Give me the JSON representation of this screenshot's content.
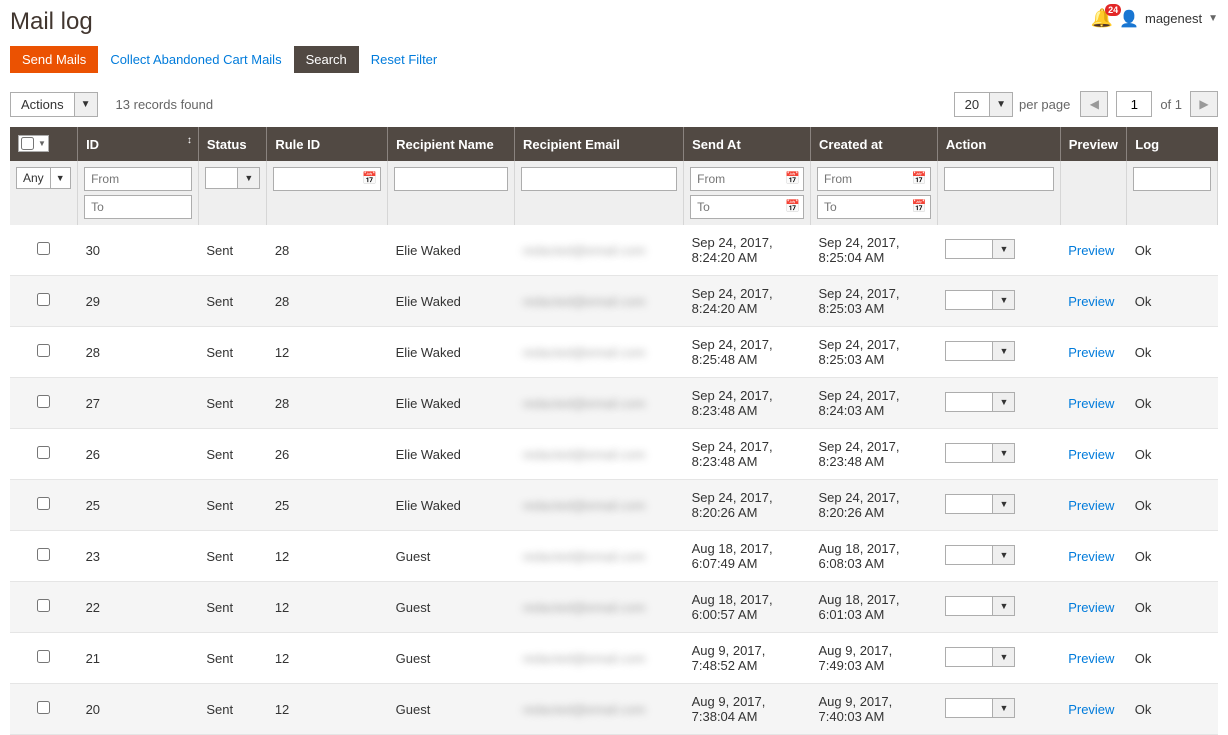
{
  "header": {
    "title": "Mail log",
    "notification_count": "24",
    "username": "magenest"
  },
  "actions": {
    "send_mails": "Send Mails",
    "collect_cart": "Collect Abandoned Cart Mails",
    "search": "Search",
    "reset_filter": "Reset Filter"
  },
  "toolbar": {
    "actions_label": "Actions",
    "records_found": "13 records found",
    "per_page_value": "20",
    "per_page_label": "per page",
    "current_page": "1",
    "total_pages": "of 1"
  },
  "columns": {
    "id": "ID",
    "status": "Status",
    "rule_id": "Rule ID",
    "recipient_name": "Recipient Name",
    "recipient_email": "Recipient Email",
    "send_at": "Send At",
    "created_at": "Created at",
    "action": "Action",
    "preview": "Preview",
    "log": "Log"
  },
  "filters": {
    "any_label": "Any",
    "from": "From",
    "to": "To"
  },
  "rows": [
    {
      "id": "30",
      "status": "Sent",
      "rule": "28",
      "name": "Elie Waked",
      "email": "redacted@email.com",
      "send": "Sep 24, 2017, 8:24:20 AM",
      "created": "Sep 24, 2017, 8:25:04 AM",
      "preview": "Preview",
      "log": "Ok"
    },
    {
      "id": "29",
      "status": "Sent",
      "rule": "28",
      "name": "Elie Waked",
      "email": "redacted@email.com",
      "send": "Sep 24, 2017, 8:24:20 AM",
      "created": "Sep 24, 2017, 8:25:03 AM",
      "preview": "Preview",
      "log": "Ok"
    },
    {
      "id": "28",
      "status": "Sent",
      "rule": "12",
      "name": "Elie Waked",
      "email": "redacted@email.com",
      "send": "Sep 24, 2017, 8:25:48 AM",
      "created": "Sep 24, 2017, 8:25:03 AM",
      "preview": "Preview",
      "log": "Ok"
    },
    {
      "id": "27",
      "status": "Sent",
      "rule": "28",
      "name": "Elie Waked",
      "email": "redacted@email.com",
      "send": "Sep 24, 2017, 8:23:48 AM",
      "created": "Sep 24, 2017, 8:24:03 AM",
      "preview": "Preview",
      "log": "Ok"
    },
    {
      "id": "26",
      "status": "Sent",
      "rule": "26",
      "name": "Elie Waked",
      "email": "redacted@email.com",
      "send": "Sep 24, 2017, 8:23:48 AM",
      "created": "Sep 24, 2017, 8:23:48 AM",
      "preview": "Preview",
      "log": "Ok"
    },
    {
      "id": "25",
      "status": "Sent",
      "rule": "25",
      "name": "Elie Waked",
      "email": "redacted@email.com",
      "send": "Sep 24, 2017, 8:20:26 AM",
      "created": "Sep 24, 2017, 8:20:26 AM",
      "preview": "Preview",
      "log": "Ok"
    },
    {
      "id": "23",
      "status": "Sent",
      "rule": "12",
      "name": "Guest",
      "email": "redacted@email.com",
      "send": "Aug 18, 2017, 6:07:49 AM",
      "created": "Aug 18, 2017, 6:08:03 AM",
      "preview": "Preview",
      "log": "Ok"
    },
    {
      "id": "22",
      "status": "Sent",
      "rule": "12",
      "name": "Guest",
      "email": "redacted@email.com",
      "send": "Aug 18, 2017, 6:00:57 AM",
      "created": "Aug 18, 2017, 6:01:03 AM",
      "preview": "Preview",
      "log": "Ok"
    },
    {
      "id": "21",
      "status": "Sent",
      "rule": "12",
      "name": "Guest",
      "email": "redacted@email.com",
      "send": "Aug 9, 2017, 7:48:52 AM",
      "created": "Aug 9, 2017, 7:49:03 AM",
      "preview": "Preview",
      "log": "Ok"
    },
    {
      "id": "20",
      "status": "Sent",
      "rule": "12",
      "name": "Guest",
      "email": "redacted@email.com",
      "send": "Aug 9, 2017, 7:38:04 AM",
      "created": "Aug 9, 2017, 7:40:03 AM",
      "preview": "Preview",
      "log": "Ok"
    }
  ]
}
